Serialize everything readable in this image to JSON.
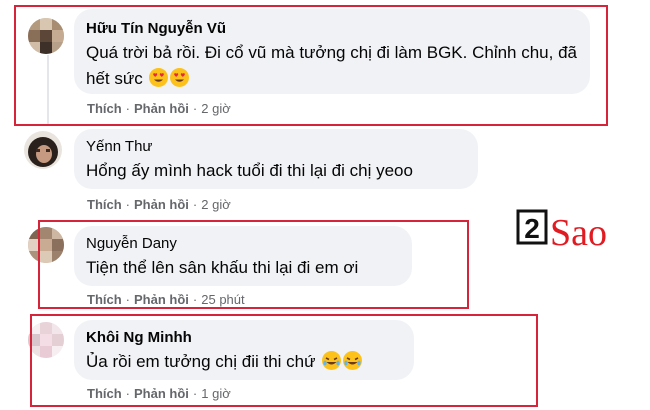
{
  "comments": [
    {
      "author": "Hữu Tín Nguyễn Vũ",
      "text": "Quá trời bả rồi. Đi cổ vũ mà tưởng chị đi làm BGK. Chỉnh chu, đã hết sức",
      "emoji": "heart-eyes",
      "like": "Thích",
      "reply": "Phản hồi",
      "time": "2 giờ"
    },
    {
      "author": "Yếnn Thư",
      "text": "Hổng ấy mình hack tuổi đi thi lại đi chị yeoo",
      "like": "Thích",
      "reply": "Phản hồi",
      "time": "2 giờ"
    },
    {
      "author": "Nguyễn Dany",
      "text": "Tiện thể lên sân khấu thi lại đi em ơi",
      "like": "Thích",
      "reply": "Phản hồi",
      "time": "25 phút"
    },
    {
      "author": "Khôi Ng Minhh",
      "text": "Ủa rồi em tưởng chị đii thi chứ",
      "emoji": "rofl",
      "like": "Thích",
      "reply": "Phản hồi",
      "time": "1 giờ"
    }
  ],
  "separator": "·",
  "watermark": {
    "digit": "2",
    "word": "Sao"
  },
  "colors": {
    "highlight_frame": "#d6253a",
    "bubble": "#f0f2f5",
    "meta_text": "#65676b",
    "watermark_red": "#e11b22"
  }
}
